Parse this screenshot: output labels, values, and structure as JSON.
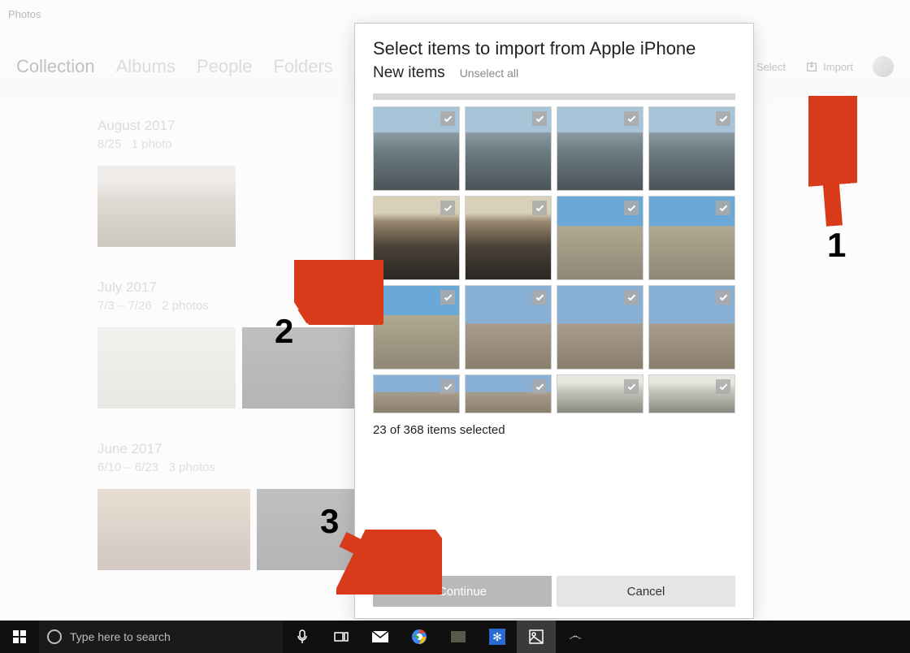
{
  "app": {
    "title": "Photos",
    "tabs": [
      "Collection",
      "Albums",
      "People",
      "Folders"
    ],
    "active_tab": 0
  },
  "header_actions": {
    "select": "Select",
    "import": "Import"
  },
  "collection_groups": [
    {
      "title": "August 2017",
      "meta_date": "8/25",
      "meta_count": "1 photo",
      "thumbs": [
        "person"
      ]
    },
    {
      "title": "July 2017",
      "meta_date": "7/3 – 7/26",
      "meta_count": "2 photos",
      "thumbs": [
        "fog",
        "dark"
      ]
    },
    {
      "title": "June 2017",
      "meta_date": "6/10 – 6/23",
      "meta_count": "3 photos",
      "thumbs": [
        "warm",
        "dark"
      ]
    }
  ],
  "dialog": {
    "title": "Select items to import from Apple iPhone",
    "subtitle": "New items",
    "unselect": "Unselect all",
    "grid": [
      [
        "sky-beach",
        "sky-beach",
        "sky-beach",
        "sky-beach"
      ],
      [
        "sunset",
        "sunset",
        "blue-beach",
        "blue-beach"
      ],
      [
        "blue-beach",
        "poles",
        "poles",
        "poles"
      ],
      [
        "poles",
        "poles",
        "ocean",
        "ocean"
      ]
    ],
    "short_last_row": true,
    "selection_text": "23 of 368 items selected",
    "continue": "Continue",
    "cancel": "Cancel"
  },
  "annotations": {
    "n1": "1",
    "n2": "2",
    "n3": "3"
  },
  "taskbar": {
    "search_placeholder": "Type here to search"
  }
}
